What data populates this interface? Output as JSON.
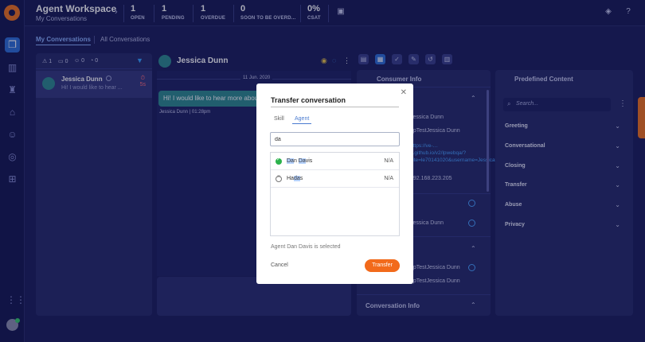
{
  "header": {
    "title": "Agent Workspace",
    "subtitle": "My Conversations",
    "stats": [
      {
        "value": "1",
        "label": "OPEN"
      },
      {
        "value": "1",
        "label": "PENDING"
      },
      {
        "value": "1",
        "label": "OVERDUE"
      },
      {
        "value": "0",
        "label": "SOON TO BE OVERD..."
      },
      {
        "value": "0%",
        "label": "CSAT"
      }
    ]
  },
  "tabs": {
    "my": "My Conversations",
    "all": "All Conversations"
  },
  "filters": [
    "1",
    "0",
    "0",
    "0"
  ],
  "conversation": {
    "name": "Jessica Dunn",
    "preview": "Hi! I would like to hear ...",
    "timer": "5s"
  },
  "chat": {
    "name": "Jessica Dunn",
    "date": "11 Jun. 2020",
    "message": "Hi! I would like to hear more about",
    "meta": "Jessica Dunn  |  01:28pm"
  },
  "consumer_info": {
    "title": "Consumer Info",
    "rows": [
      "Jessica Dunn",
      "ppTestJessica Dunn"
    ],
    "link": "https://ve-…p.github.io/v2/lpwebqa/?site=le70141020&username=Jessica%20Dunn",
    "ip": "192.168.223.205",
    "row2": "Jessica Dunn",
    "row3": "ppTestJessica Dunn",
    "row4": "ppTestJessica Dunn",
    "conversation_info": "Conversation Info"
  },
  "predefined": {
    "title": "Predefined Content",
    "search_placeholder": "Search...",
    "categories": [
      "Greeting",
      "Conversational",
      "Closing",
      "Transfer",
      "Abuse",
      "Privacy"
    ]
  },
  "modal": {
    "title": "Transfer conversation",
    "tabs": {
      "skill": "Skill",
      "agent": "Agent"
    },
    "search_value": "da",
    "agents": [
      {
        "pre": "",
        "hl": "Da",
        "mid": "n ",
        "hl2": "Da",
        "post": "vis",
        "status": "online",
        "value": "N/A"
      },
      {
        "pre": "Ha",
        "hl": "da",
        "mid": "s",
        "hl2": "",
        "post": "",
        "status": "away",
        "value": "N/A"
      }
    ],
    "selected_text": "Agent Dan Davis is selected",
    "cancel": "Cancel",
    "transfer": "Transfer"
  },
  "colors": {
    "accent": "#f26a1b",
    "brand": "#f0731f",
    "link": "#4aa3ff",
    "background": "#1c1f5c"
  }
}
